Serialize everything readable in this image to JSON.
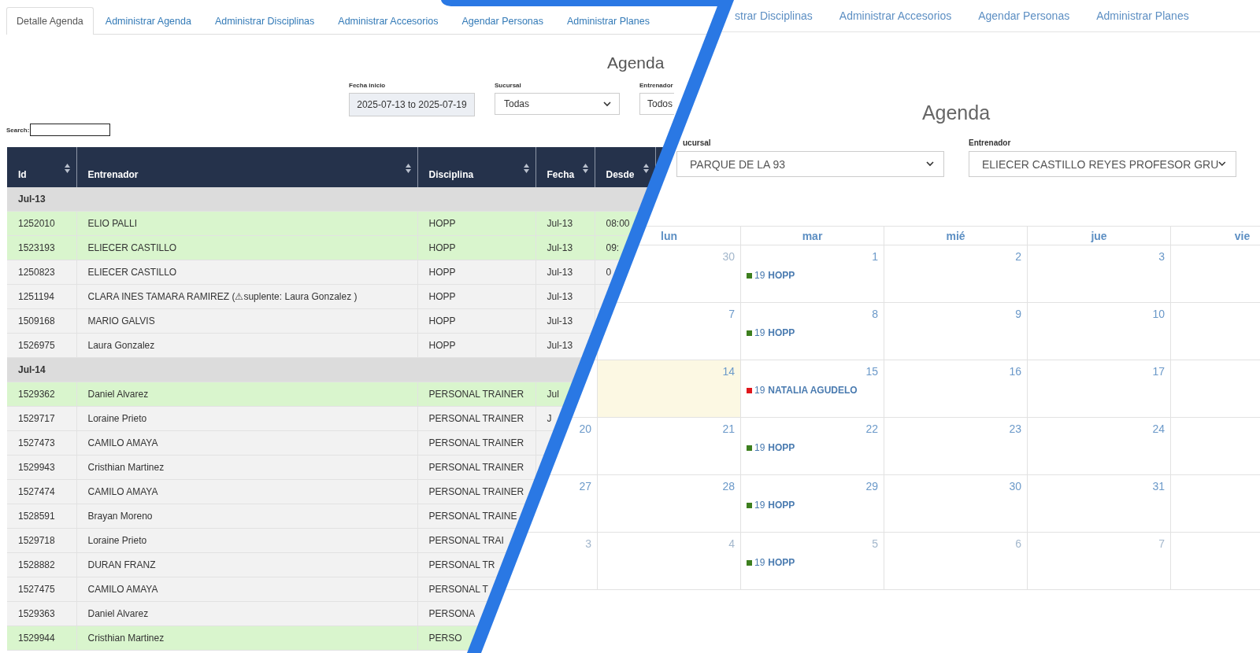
{
  "left_window": {
    "tabs": [
      {
        "label": "Detalle Agenda",
        "selected": true
      },
      {
        "label": "Administrar Agenda",
        "selected": false
      },
      {
        "label": "Administrar Disciplinas",
        "selected": false
      },
      {
        "label": "Administrar Accesorios",
        "selected": false
      },
      {
        "label": "Agendar Personas",
        "selected": false
      },
      {
        "label": "Administrar Planes",
        "selected": false
      }
    ],
    "title": "Agenda",
    "filters": [
      {
        "label": "Fecha inicio",
        "kind": "date",
        "value": "2025-07-13 to 2025-07-19"
      },
      {
        "label": "Sucursal",
        "kind": "select",
        "value": "Todas"
      },
      {
        "label": "Entrenador",
        "kind": "select",
        "value": "Todos"
      }
    ],
    "search": {
      "label": "Search:"
    },
    "table": {
      "columns": [
        "Id",
        "Entrenador",
        "Disciplina",
        "Fecha",
        "Desde"
      ],
      "rows": [
        {
          "kind": "group",
          "label": "Jul-13"
        },
        {
          "kind": "entry",
          "highlighted": true,
          "cells": [
            "1252010",
            "ELIO PALLI",
            "HOPP",
            "Jul-13",
            "08:00"
          ]
        },
        {
          "kind": "entry",
          "highlighted": true,
          "cells": [
            "1523193",
            "ELIECER CASTILLO",
            "HOPP",
            "Jul-13",
            "09:"
          ]
        },
        {
          "kind": "entry",
          "highlighted": false,
          "cells": [
            "1250823",
            "ELIECER CASTILLO",
            "HOPP",
            "Jul-13",
            "0"
          ]
        },
        {
          "kind": "entry",
          "highlighted": false,
          "cells": [
            "1251194",
            "CLARA INES TAMARA RAMIREZ (⚠suplente: Laura Gonzalez )",
            "HOPP",
            "Jul-13"
          ]
        },
        {
          "kind": "entry",
          "highlighted": false,
          "cells": [
            "1509168",
            "MARIO GALVIS",
            "HOPP",
            "Jul-13"
          ]
        },
        {
          "kind": "entry",
          "highlighted": false,
          "cells": [
            "1526975",
            "Laura Gonzalez",
            "HOPP",
            "Jul-13"
          ]
        },
        {
          "kind": "group",
          "label": "Jul-14"
        },
        {
          "kind": "entry",
          "highlighted": true,
          "cells": [
            "1529362",
            "Daniel Alvarez",
            "PERSONAL TRAINER",
            "Jul"
          ]
        },
        {
          "kind": "entry",
          "highlighted": false,
          "cells": [
            "1529717",
            "Loraine Prieto",
            "PERSONAL TRAINER",
            "J"
          ]
        },
        {
          "kind": "entry",
          "highlighted": false,
          "cells": [
            "1527473",
            "CAMILO AMAYA",
            "PERSONAL TRAINER"
          ]
        },
        {
          "kind": "entry",
          "highlighted": false,
          "cells": [
            "1529943",
            "Cristhian Martinez",
            "PERSONAL TRAINER"
          ]
        },
        {
          "kind": "entry",
          "highlighted": false,
          "cells": [
            "1527474",
            "CAMILO AMAYA",
            "PERSONAL TRAINER"
          ]
        },
        {
          "kind": "entry",
          "highlighted": false,
          "cells": [
            "1528591",
            "Brayan Moreno",
            "PERSONAL TRAINE"
          ]
        },
        {
          "kind": "entry",
          "highlighted": false,
          "cells": [
            "1529718",
            "Loraine Prieto",
            "PERSONAL TRAI"
          ]
        },
        {
          "kind": "entry",
          "highlighted": false,
          "cells": [
            "1528882",
            "DURAN FRANZ",
            "PERSONAL TR"
          ]
        },
        {
          "kind": "entry",
          "highlighted": false,
          "cells": [
            "1527475",
            "CAMILO AMAYA",
            "PERSONAL T"
          ]
        },
        {
          "kind": "entry",
          "highlighted": false,
          "cells": [
            "1529363",
            "Daniel Alvarez",
            "PERSONA"
          ]
        },
        {
          "kind": "entry",
          "highlighted": true,
          "cells": [
            "1529944",
            "Cristhian Martinez",
            "PERSO"
          ]
        }
      ]
    }
  },
  "right_window": {
    "tabs": [
      {
        "label": "strar Disciplinas",
        "selected": false
      },
      {
        "label": "Administrar Accesorios",
        "selected": false
      },
      {
        "label": "Agendar Personas",
        "selected": false
      },
      {
        "label": "Administrar Planes",
        "selected": false
      }
    ],
    "title": "Agenda",
    "filters": [
      {
        "label": "ucursal",
        "value": "PARQUE DE LA 93"
      },
      {
        "label": "Entrenador",
        "value": "ELIECER CASTILLO REYES PROFESOR GRU"
      }
    ],
    "calendar": {
      "weekdays": [
        "lun",
        "mar",
        "mié",
        "jue",
        "vie"
      ],
      "weeks": [
        {
          "days": [
            {
              "number": "30",
              "other_month": true,
              "today": false
            },
            {
              "number": "1",
              "other_month": false,
              "today": false,
              "events": [
                {
                  "time": "19",
                  "title": "HOPP",
                  "color": "#3d7f1e"
                }
              ]
            },
            {
              "number": "2",
              "other_month": false,
              "today": false
            },
            {
              "number": "3",
              "other_month": false,
              "today": false
            }
          ]
        },
        {
          "days": [
            {
              "number": "7",
              "other_month": false,
              "today": false
            },
            {
              "number": "8",
              "other_month": false,
              "today": false,
              "events": [
                {
                  "time": "19",
                  "title": "HOPP",
                  "color": "#3d7f1e"
                }
              ]
            },
            {
              "number": "9",
              "other_month": false,
              "today": false
            },
            {
              "number": "10",
              "other_month": false,
              "today": false
            }
          ]
        },
        {
          "days": [
            {
              "number": "14",
              "other_month": false,
              "today": true
            },
            {
              "number": "15",
              "other_month": false,
              "today": false,
              "events": [
                {
                  "time": "19",
                  "title": "NATALIA AGUDELO",
                  "color": "#e0161b"
                }
              ]
            },
            {
              "number": "16",
              "other_month": false,
              "today": false
            },
            {
              "number": "17",
              "other_month": false,
              "today": false
            }
          ]
        },
        {
          "sunday": {
            "number": "20",
            "other_month": false
          },
          "days": [
            {
              "number": "21",
              "other_month": false,
              "today": false
            },
            {
              "number": "22",
              "other_month": false,
              "today": false,
              "events": [
                {
                  "time": "19",
                  "title": "HOPP",
                  "color": "#3d7f1e"
                }
              ]
            },
            {
              "number": "23",
              "other_month": false,
              "today": false
            },
            {
              "number": "24",
              "other_month": false,
              "today": false
            }
          ]
        },
        {
          "sunday": {
            "number": "27",
            "other_month": false
          },
          "days": [
            {
              "number": "28",
              "other_month": false,
              "today": false
            },
            {
              "number": "29",
              "other_month": false,
              "today": false,
              "events": [
                {
                  "time": "19",
                  "title": "HOPP",
                  "color": "#3d7f1e"
                }
              ]
            },
            {
              "number": "30",
              "other_month": false,
              "today": false
            },
            {
              "number": "31",
              "other_month": false,
              "today": false
            }
          ]
        },
        {
          "sunday": {
            "number": "3",
            "other_month": true
          },
          "days": [
            {
              "number": "4",
              "other_month": true,
              "today": false
            },
            {
              "number": "5",
              "other_month": true,
              "today": false,
              "events": [
                {
                  "time": "19",
                  "title": "HOPP",
                  "color": "#3d7f1e"
                }
              ]
            },
            {
              "number": "6",
              "other_month": true,
              "today": false
            },
            {
              "number": "7",
              "other_month": true,
              "today": false
            }
          ]
        }
      ]
    }
  }
}
